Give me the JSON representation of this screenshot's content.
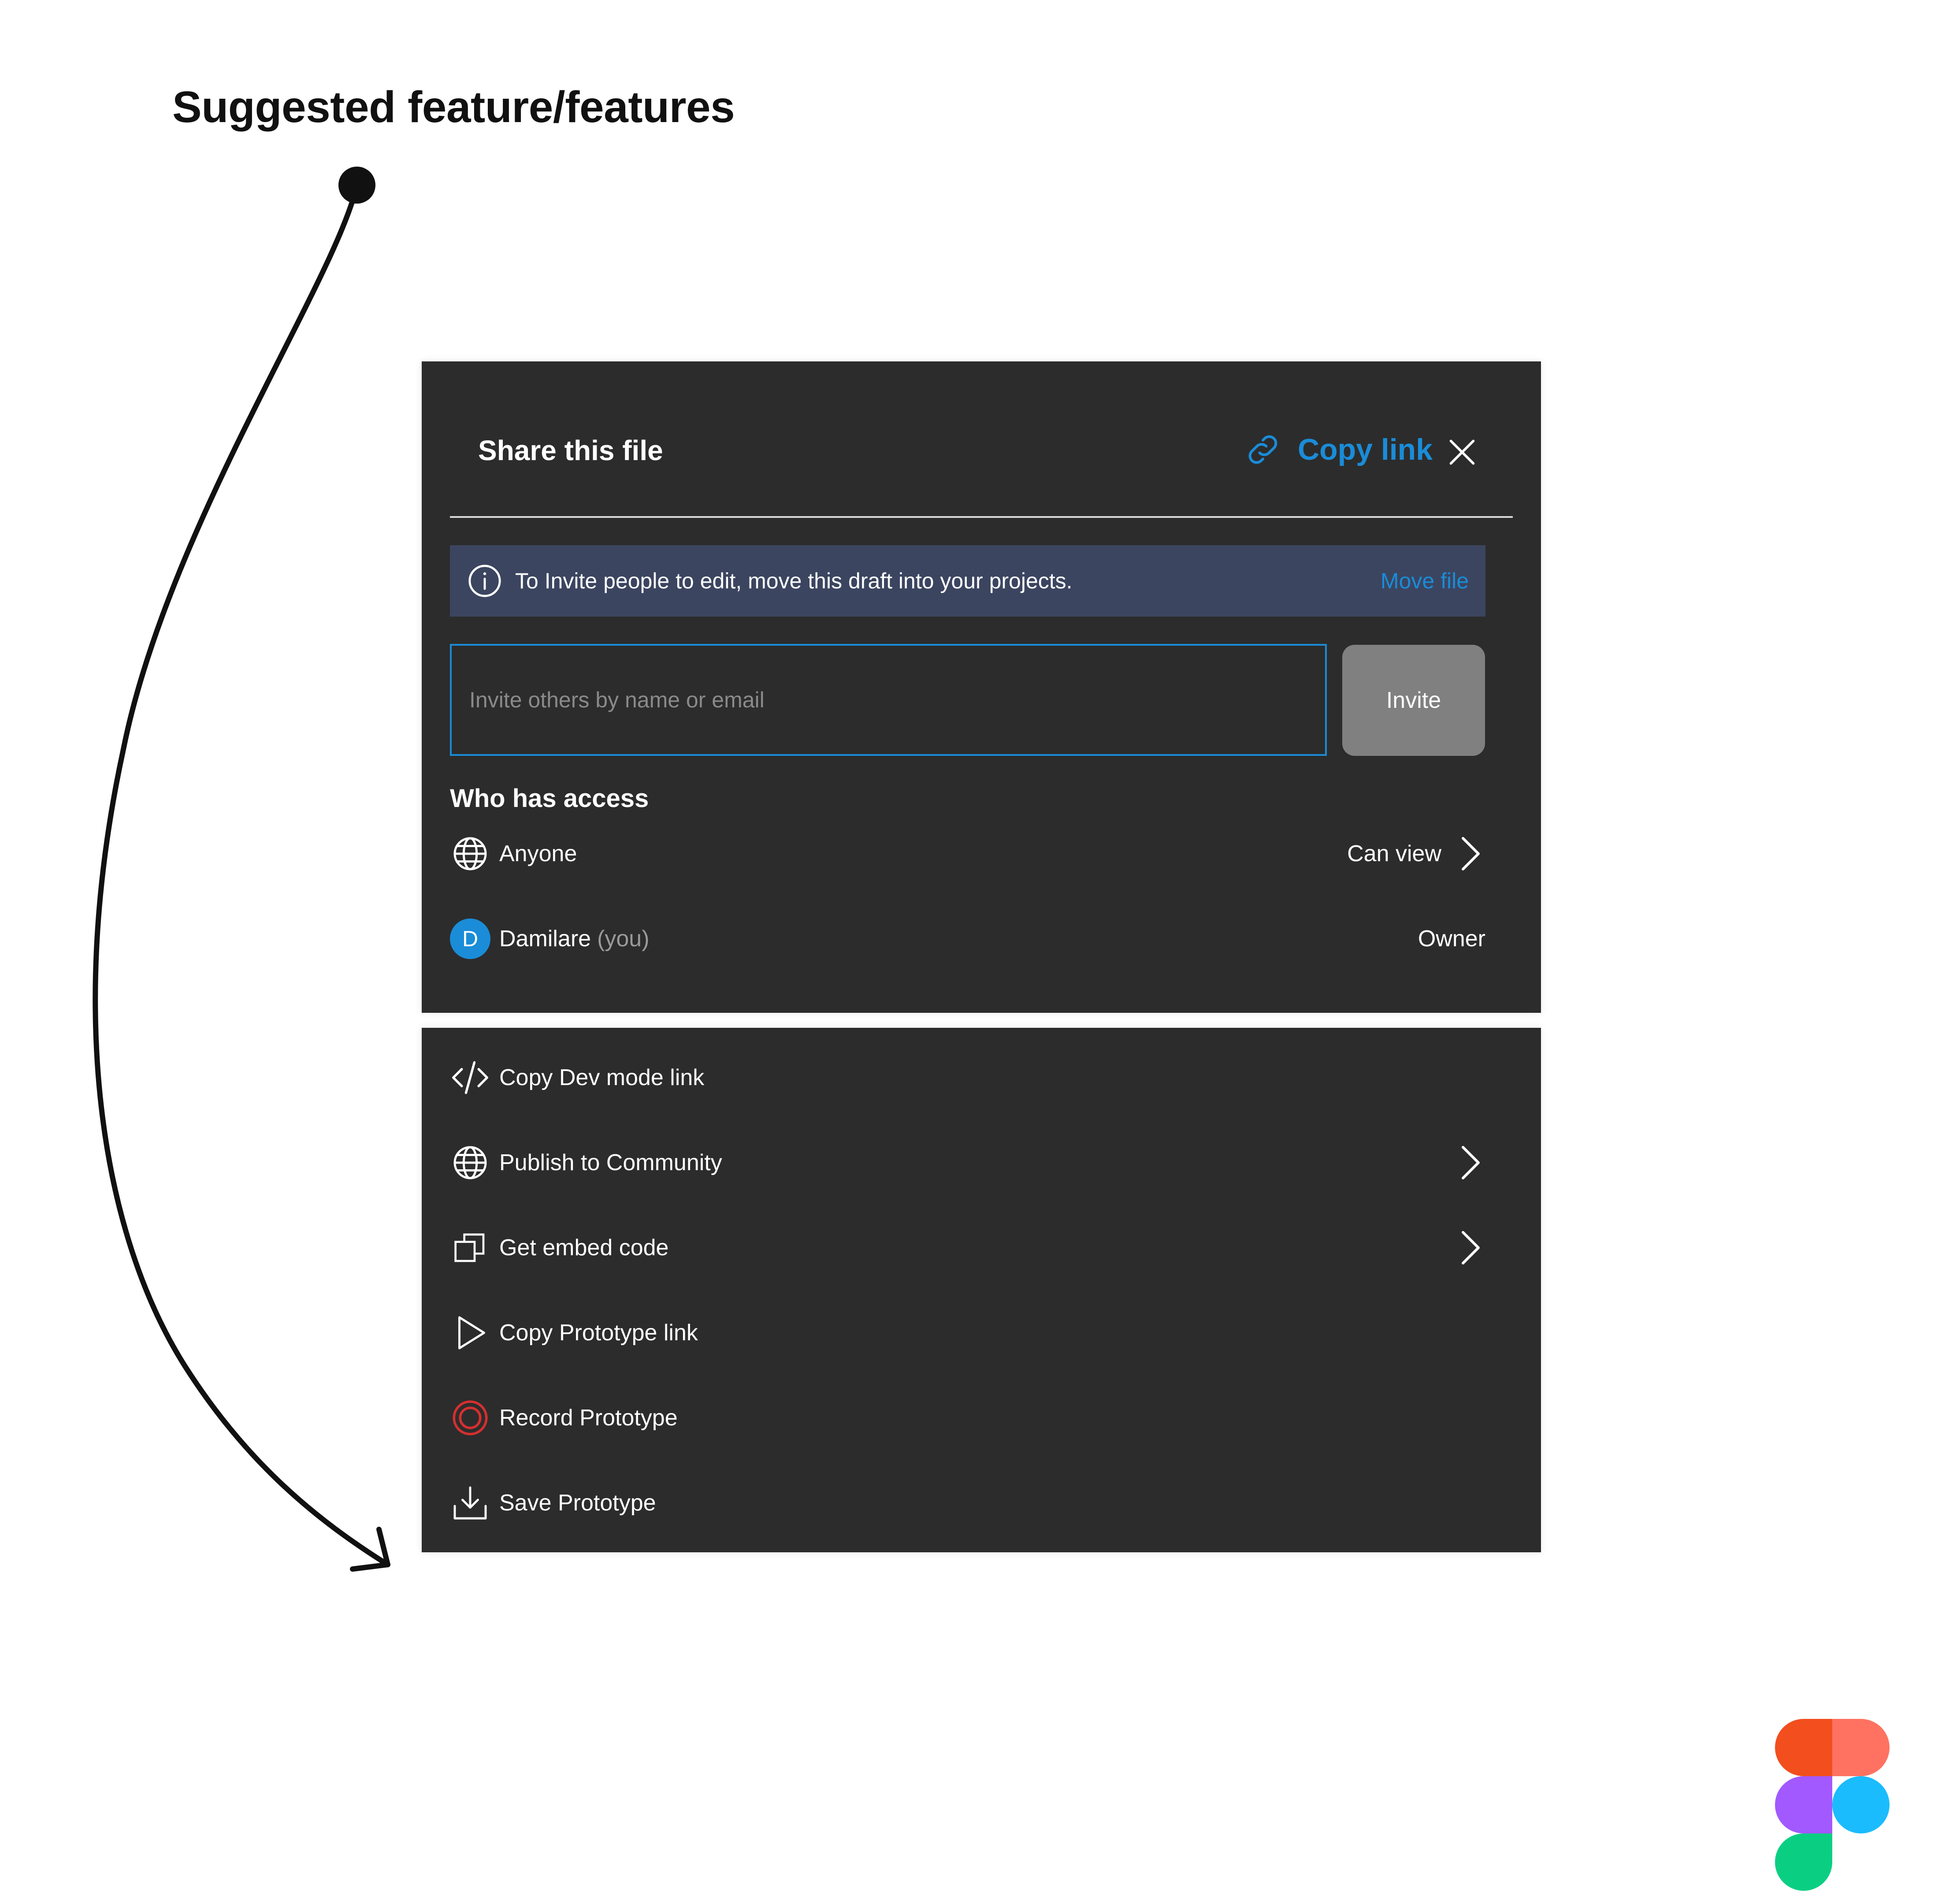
{
  "heading": "Suggested feature/features",
  "dialog": {
    "title": "Share this file",
    "copy_link": "Copy link",
    "banner": {
      "message": "To Invite people to edit, move this draft into your projects.",
      "action": "Move file"
    },
    "invite": {
      "placeholder": "Invite others by name or email",
      "button": "Invite"
    },
    "access_title": "Who has access",
    "access": [
      {
        "icon": "globe-icon",
        "name": "Anyone",
        "role": "Can view"
      },
      {
        "avatar_initial": "D",
        "name": "Damilare",
        "suffix": "(you)",
        "role": "Owner"
      }
    ]
  },
  "actions": [
    {
      "icon": "code-icon",
      "label": "Copy Dev mode link"
    },
    {
      "icon": "globe-icon",
      "label": "Publish to Community",
      "chevron": true
    },
    {
      "icon": "embed-icon",
      "label": "Get embed code",
      "chevron": true
    },
    {
      "icon": "play-icon",
      "label": "Copy Prototype link"
    },
    {
      "icon": "record-icon",
      "label": "Record Prototype"
    },
    {
      "icon": "download-icon",
      "label": "Save Prototype"
    }
  ],
  "colors": {
    "accent": "#1a8cd8",
    "panel": "#2c2c2c",
    "banner": "#3b4560",
    "record": "#d62f2f"
  }
}
